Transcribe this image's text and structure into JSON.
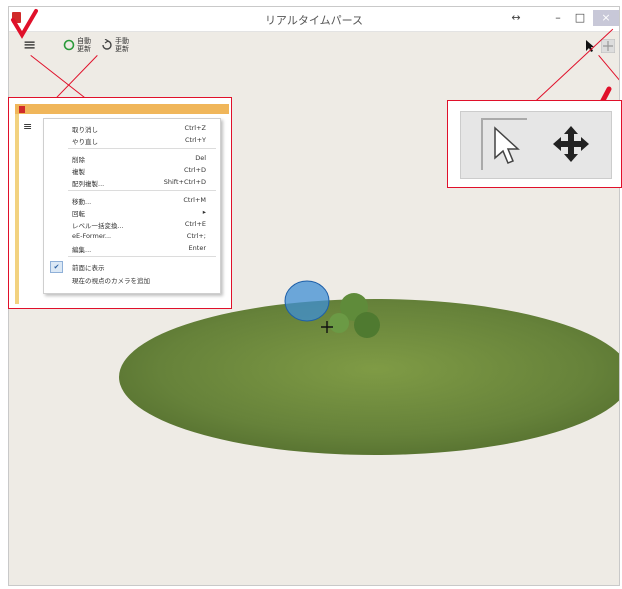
{
  "window": {
    "title": "リアルタイムパース"
  },
  "titlebar_buttons": {
    "resize": "↔",
    "minimize": "–",
    "maximize": "□",
    "close": "×"
  },
  "toolbar": {
    "hamburger": "≡",
    "auto_update": "自動\n更新",
    "manual_update": "手動\n更新"
  },
  "context_menu": {
    "items": [
      {
        "label": "取り消し",
        "shortcut": "Ctrl+Z"
      },
      {
        "label": "やり直し",
        "shortcut": "Ctrl+Y"
      },
      {
        "label": "削除",
        "shortcut": "Del"
      },
      {
        "label": "複製",
        "shortcut": "Ctrl+D"
      },
      {
        "label": "配列複製...",
        "shortcut": "Shift+Ctrl+D"
      },
      {
        "label": "移動...",
        "shortcut": "Ctrl+M"
      },
      {
        "label": "回転",
        "shortcut": "▸"
      },
      {
        "label": "レベル一括変換...",
        "shortcut": "Ctrl+E"
      },
      {
        "label": "eE-Former...",
        "shortcut": "Ctrl+;"
      },
      {
        "label": "編集...",
        "shortcut": "Enter"
      },
      {
        "label": "前面に表示",
        "shortcut": ""
      },
      {
        "label": "現在の視点のカメラを追加",
        "shortcut": ""
      }
    ]
  },
  "colors": {
    "accent_red": "#e0102a",
    "menu_header": "#f0b65a",
    "ground_green": "#6e8a37"
  }
}
